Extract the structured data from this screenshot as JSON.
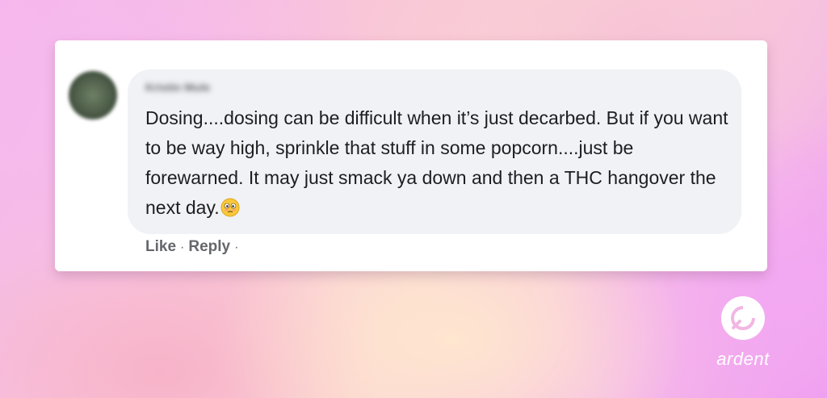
{
  "comment": {
    "author_name": "Kristin Mule",
    "text": "Dosing....dosing can be difficult when it’s just decarbed. But if you want to be way high, sprinkle that stuff in some popcorn....just be forewarned. It may just smack ya down and then a THC hangover the next day.",
    "emoji": "flushed-face",
    "actions": {
      "like_label": "Like",
      "reply_label": "Reply",
      "separator": "·"
    }
  },
  "brand": {
    "name": "ardent",
    "logo_icon": "ardent-logo-icon"
  },
  "colors": {
    "bubble_background": "#f0f2f5",
    "card_background": "#ffffff",
    "text": "#1c1e21",
    "muted_text": "#65676b"
  }
}
